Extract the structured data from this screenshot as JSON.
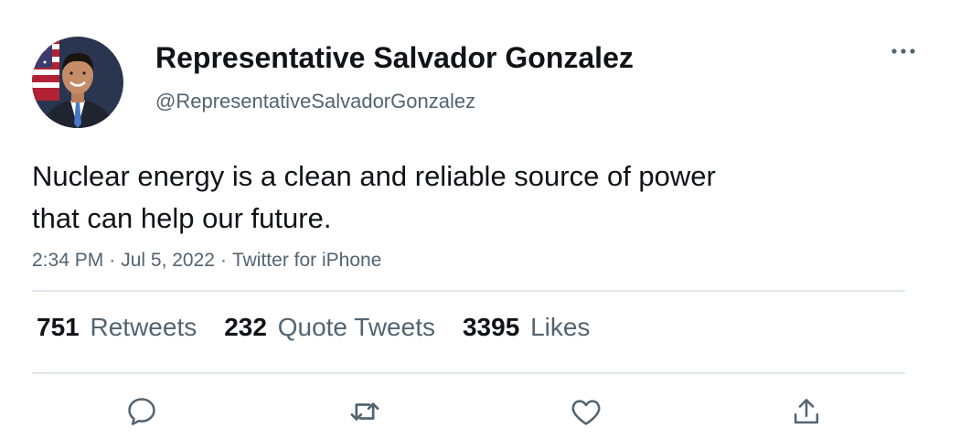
{
  "author": {
    "display_name": "Representative Salvador Gonzalez",
    "handle": "@RepresentativeSalvadorGonzalez"
  },
  "tweet": {
    "text": "Nuclear energy is a clean and reliable source of power\nthat can help our future.",
    "time": "2:34 PM",
    "date": "Jul 5, 2022",
    "source": "Twitter for iPhone",
    "separator": "·"
  },
  "stats": {
    "retweets": {
      "count": "751",
      "label": "Retweets"
    },
    "quote_tweets": {
      "count": "232",
      "label": "Quote Tweets"
    },
    "likes": {
      "count": "3395",
      "label": "Likes"
    }
  },
  "actions": [
    "reply-icon",
    "retweet-icon",
    "like-icon",
    "share-icon"
  ],
  "colors": {
    "text_primary": "#0f1419",
    "text_secondary": "#536471",
    "divider": "#e1e6ea"
  }
}
